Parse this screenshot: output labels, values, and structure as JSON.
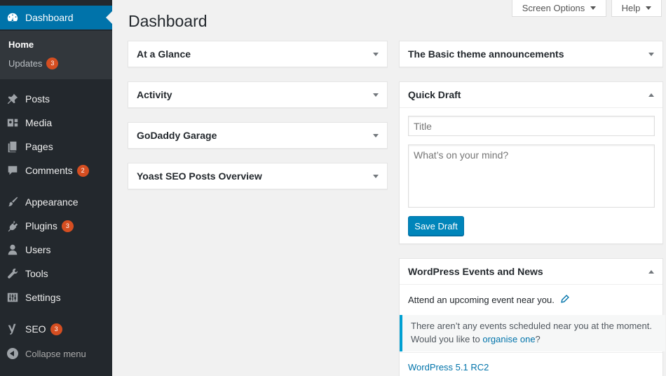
{
  "sidebar": {
    "dashboard": {
      "label": "Dashboard",
      "icon": "dashboard-gauge-icon"
    },
    "submenu": {
      "home": "Home",
      "updates": {
        "label": "Updates",
        "count": "3"
      }
    },
    "items": [
      {
        "key": "posts",
        "label": "Posts",
        "icon": "pin-icon"
      },
      {
        "key": "media",
        "label": "Media",
        "icon": "media-icon"
      },
      {
        "key": "pages",
        "label": "Pages",
        "icon": "pages-icon"
      },
      {
        "key": "comments",
        "label": "Comments",
        "icon": "comment-bubble-icon",
        "count": "2"
      },
      {
        "key": "appearance",
        "label": "Appearance",
        "icon": "paintbrush-icon"
      },
      {
        "key": "plugins",
        "label": "Plugins",
        "icon": "plug-icon",
        "count": "3"
      },
      {
        "key": "users",
        "label": "Users",
        "icon": "user-icon"
      },
      {
        "key": "tools",
        "label": "Tools",
        "icon": "wrench-icon"
      },
      {
        "key": "settings",
        "label": "Settings",
        "icon": "sliders-icon"
      },
      {
        "key": "seo",
        "label": "SEO",
        "icon": "yoast-icon",
        "count": "3"
      }
    ],
    "collapse": "Collapse menu"
  },
  "header": {
    "screen_options": "Screen Options",
    "help": "Help",
    "title": "Dashboard"
  },
  "widgets_left": [
    {
      "title": "At a Glance"
    },
    {
      "title": "Activity"
    },
    {
      "title": "GoDaddy Garage"
    },
    {
      "title": "Yoast SEO Posts Overview"
    }
  ],
  "widgets_right": {
    "announcements": {
      "title": "The Basic theme announcements"
    },
    "quick_draft": {
      "title": "Quick Draft",
      "title_placeholder": "Title",
      "content_placeholder": "What’s on your mind?",
      "save_label": "Save Draft"
    },
    "events": {
      "title": "WordPress Events and News",
      "attend_text": "Attend an upcoming event near you.",
      "notice_line1": "There aren’t any events scheduled near you at the moment.",
      "notice_line2_prefix": "Would you like to ",
      "notice_link": "organise one",
      "notice_line2_suffix": "?",
      "news_link": "WordPress 5.1 RC2"
    }
  },
  "colors": {
    "sidebar_bg": "#23282d",
    "submenu_bg": "#32373c",
    "accent": "#0073aa",
    "badge": "#d54e21",
    "page_bg": "#f1f1f1"
  }
}
